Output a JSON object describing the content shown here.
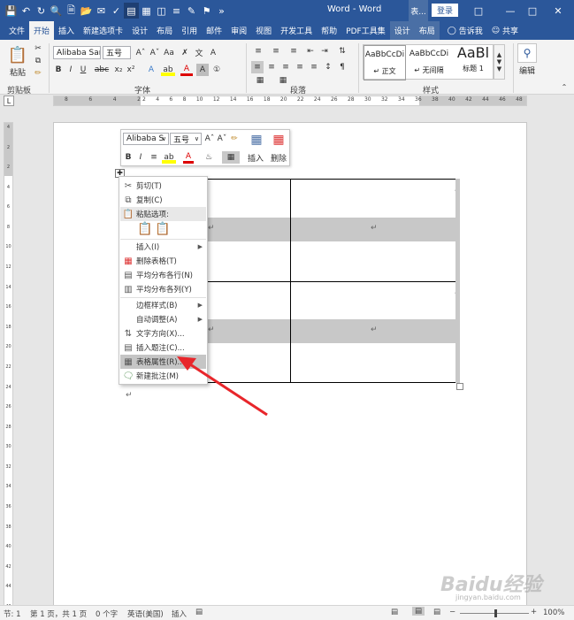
{
  "window": {
    "app_title": "Word - Word",
    "context_title_tab": "表...",
    "login_label": "登录",
    "tell_me": "告诉我",
    "share": "共享"
  },
  "tabs": [
    "文件",
    "开始",
    "插入",
    "新建选项卡",
    "设计",
    "布局",
    "引用",
    "邮件",
    "审阅",
    "视图",
    "开发工具",
    "帮助",
    "PDF工具集",
    "设计",
    "布局"
  ],
  "ribbon": {
    "clipboard": {
      "paste": "粘贴",
      "label": "剪贴板"
    },
    "font": {
      "name": "Alibaba Sans",
      "size": "五号",
      "label": "字体"
    },
    "paragraph": {
      "label": "段落"
    },
    "styles": {
      "label": "样式",
      "items": [
        {
          "preview": "AaBbCcDi",
          "name": "↵ 正文"
        },
        {
          "preview": "AaBbCcDi",
          "name": "↵ 无间隔"
        },
        {
          "preview": "AaBl",
          "name": "标题 1"
        }
      ]
    },
    "editing": {
      "label": "编辑"
    }
  },
  "ruler_h": {
    "left": [
      "8",
      "6",
      "4",
      "2"
    ],
    "right": [
      "2",
      "4",
      "6",
      "8",
      "10",
      "12",
      "14",
      "16",
      "18",
      "20",
      "22",
      "24",
      "26",
      "28",
      "30",
      "32",
      "34",
      "36",
      "38",
      "40",
      "42",
      "44",
      "46",
      "48"
    ]
  },
  "ruler_v": [
    "4",
    "2",
    "2",
    "4",
    "6",
    "8",
    "10",
    "12",
    "14",
    "16",
    "18",
    "20",
    "22",
    "24",
    "26",
    "28",
    "30",
    "32",
    "34",
    "36",
    "38",
    "40",
    "42",
    "44",
    "46"
  ],
  "minibar": {
    "font": "Alibaba S",
    "size": "五号",
    "insert_label": "插入",
    "delete_label": "删除"
  },
  "table": {
    "cell_return": "↵",
    "after_table_return": "↵"
  },
  "context_menu": {
    "items": [
      {
        "icon": "scissors-icon",
        "label": "剪切(T)"
      },
      {
        "icon": "copy-icon",
        "label": "复制(C)"
      },
      {
        "icon": "paste-icon",
        "label": "粘贴选项:"
      },
      {
        "icon": "",
        "label": "插入(I)"
      },
      {
        "icon": "delete-table-icon",
        "label": "删除表格(T)"
      },
      {
        "icon": "distribute-rows-icon",
        "label": "平均分布各行(N)"
      },
      {
        "icon": "distribute-columns-icon",
        "label": "平均分布各列(Y)"
      },
      {
        "icon": "",
        "label": "边框样式(B)"
      },
      {
        "icon": "",
        "label": "自动调整(A)"
      },
      {
        "icon": "text-direction-icon",
        "label": "文字方向(X)..."
      },
      {
        "icon": "insert-caption-icon",
        "label": "插入题注(C)..."
      },
      {
        "icon": "table-properties-icon",
        "label": "表格属性(R)..."
      },
      {
        "icon": "new-comment-icon",
        "label": "新建批注(M)"
      }
    ]
  },
  "statusbar": {
    "section": "节: 1",
    "page": "第 1 页，共 1 页",
    "words": "0 个字",
    "language": "英语(美国)",
    "mode": "插入",
    "zoom": "100%"
  },
  "watermark": {
    "text": "Baidu经验",
    "sub": "jingyan.baidu.com"
  },
  "colors": {
    "brand": "#2b579a",
    "annotation_arrow": "#e8262b"
  }
}
